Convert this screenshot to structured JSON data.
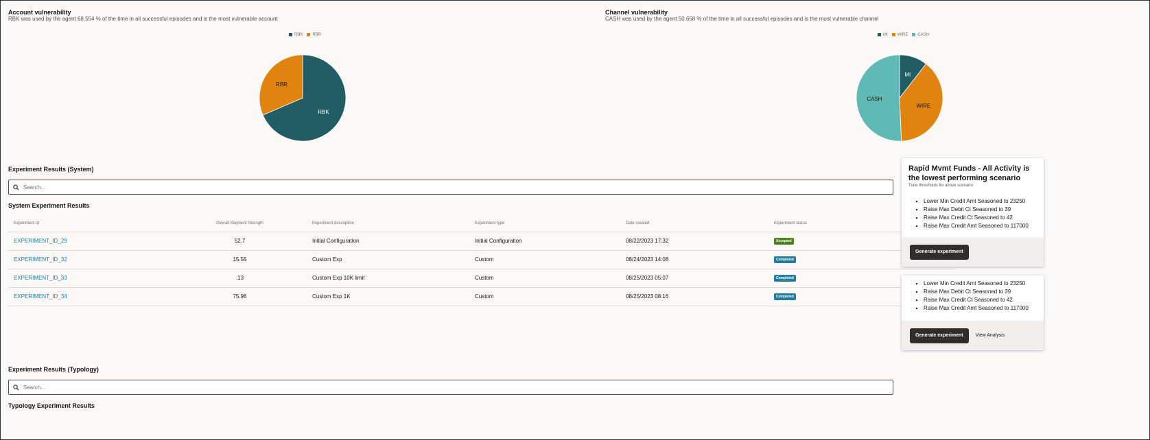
{
  "account": {
    "title": "Account vulnerability",
    "subtitle": "RBK was used by the agent 68.554 % of the time in all successful episodes and is the most vulnerable account",
    "chart_data": {
      "type": "pie",
      "categories": [
        "RBK",
        "RBR"
      ],
      "values": [
        68.554,
        31.446
      ],
      "colors": [
        "#225c64",
        "#e0830f"
      ],
      "legend_position": "top"
    }
  },
  "channel": {
    "title": "Channel vulnerability",
    "subtitle": "CASH was used by the agent 50.658 % of the time in all successful episodes and is the most vulnerable channel",
    "chart_data": {
      "type": "pie",
      "categories": [
        "MI",
        "WIRE",
        "CASH"
      ],
      "values": [
        10.5,
        38.842,
        50.658
      ],
      "colors": [
        "#225c64",
        "#e0830f",
        "#5fbab6"
      ],
      "legend_position": "top"
    }
  },
  "system": {
    "section_title": "Experiment Results (System)",
    "search_placeholder": "Search...",
    "table_title": "System Experiment Results",
    "columns": [
      "Experiment Id",
      "Overall Segment Strength",
      "Experiment description",
      "Experiment type",
      "Date created",
      "Experiment status"
    ],
    "rows": [
      {
        "id": "EXPERIMENT_ID_29",
        "strength": "52.7",
        "desc": "Initial Configuration",
        "type": "Initial Configuration",
        "date": "08/22/2023 17:32",
        "status": "Accepted",
        "status_color": "#508223"
      },
      {
        "id": "EXPERIMENT_ID_32",
        "strength": "15.55",
        "desc": "Custom Exp",
        "type": "Custom",
        "date": "08/24/2023 14:08",
        "status": "Completed",
        "status_color": "#227e9e"
      },
      {
        "id": "EXPERIMENT_ID_33",
        "strength": ".13",
        "desc": "Custom Exp 10K limit",
        "type": "Custom",
        "date": "08/25/2023 05:07",
        "status": "Completed",
        "status_color": "#227e9e"
      },
      {
        "id": "EXPERIMENT_ID_34",
        "strength": "75.96",
        "desc": "Custom Exp 1K",
        "type": "Custom",
        "date": "08/25/2023 08:16",
        "status": "Completed",
        "status_color": "#227e9e"
      }
    ]
  },
  "typology": {
    "section_title": "Experiment Results (Typology)",
    "search_placeholder": "Search...",
    "table_title": "Typology Experiment Results"
  },
  "card1": {
    "title": "Rapid Mvmt Funds - All Activity is the lowest performing scenario",
    "subtitle": "Tune thresholds for above scenario",
    "items": [
      "Lower Min Credit Amt Seasoned to 23250",
      "Raise Max Debit Ct Seasoned to 39",
      "Raise Max Credit Ct Seasoned to 42",
      "Raise Max Credit Amt Seasoned to 117000"
    ],
    "button": "Generate experiment"
  },
  "card2": {
    "items": [
      "Lower Min Credit Amt Seasoned to 23250",
      "Raise Max Debit Ct Seasoned to 39",
      "Raise Max Credit Ct Seasoned to 42",
      "Raise Max Credit Amt Seasoned to 117000"
    ],
    "button": "Generate experiment",
    "link": "View Analysis"
  }
}
